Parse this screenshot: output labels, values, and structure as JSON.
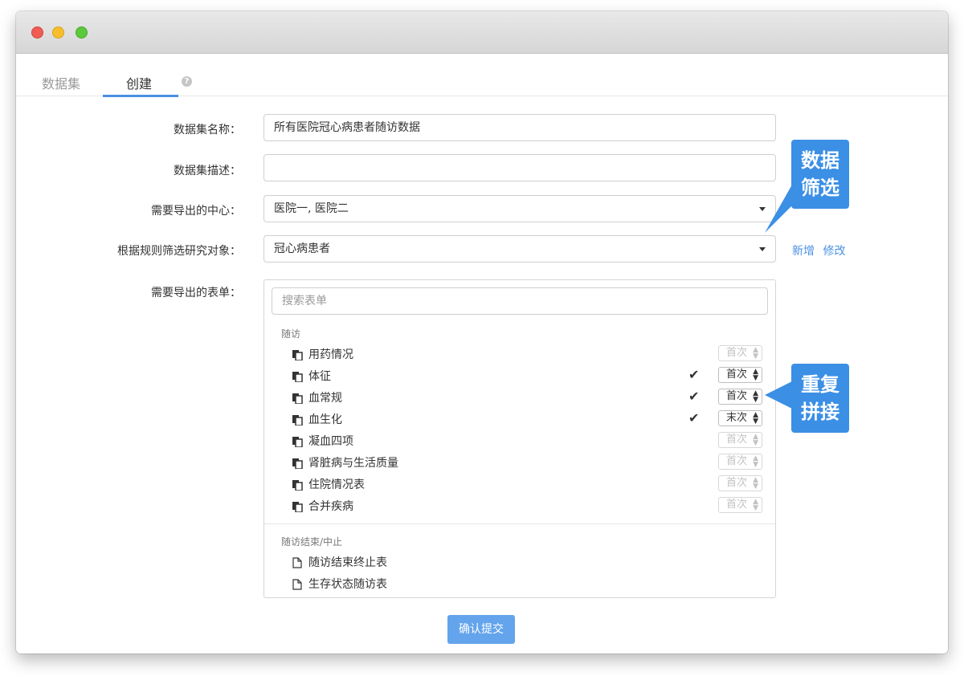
{
  "tabs": {
    "dataset": "数据集",
    "create": "创建",
    "help_icon": "question-circle-icon"
  },
  "form": {
    "name_label": "数据集名称：",
    "name_value": "所有医院冠心病患者随访数据",
    "desc_label": "数据集描述：",
    "desc_value": "",
    "center_label": "需要导出的中心：",
    "center_value": "医院一, 医院二",
    "rule_label": "根据规则筛选研究对象：",
    "rule_value": "冠心病患者",
    "add_link": "新增",
    "edit_link": "修改",
    "forms_label": "需要导出的表单："
  },
  "forms": {
    "search_placeholder": "搜索表单",
    "group1_title": "随访",
    "group1_items": [
      {
        "name": "用药情况",
        "checked": false,
        "select": "首次"
      },
      {
        "name": "体征",
        "checked": true,
        "select": "首次"
      },
      {
        "name": "血常规",
        "checked": true,
        "select": "首次"
      },
      {
        "name": "血生化",
        "checked": true,
        "select": "末次"
      },
      {
        "name": "凝血四项",
        "checked": false,
        "select": "首次"
      },
      {
        "name": "肾脏病与生活质量",
        "checked": false,
        "select": "首次"
      },
      {
        "name": "住院情况表",
        "checked": false,
        "select": "首次"
      },
      {
        "name": "合并疾病",
        "checked": false,
        "select": "首次"
      }
    ],
    "group2_title": "随访结束/中止",
    "group2_items": [
      {
        "name": "随访结束终止表"
      },
      {
        "name": "生存状态随访表"
      }
    ]
  },
  "submit_label": "确认提交",
  "callouts": {
    "filter_line1": "数据",
    "filter_line2": "筛选",
    "repeat_line1": "重复",
    "repeat_line2": "拼接"
  },
  "colors": {
    "accent": "#4a90e2",
    "callout": "#3b8fe5",
    "submit": "#63a4ec"
  }
}
